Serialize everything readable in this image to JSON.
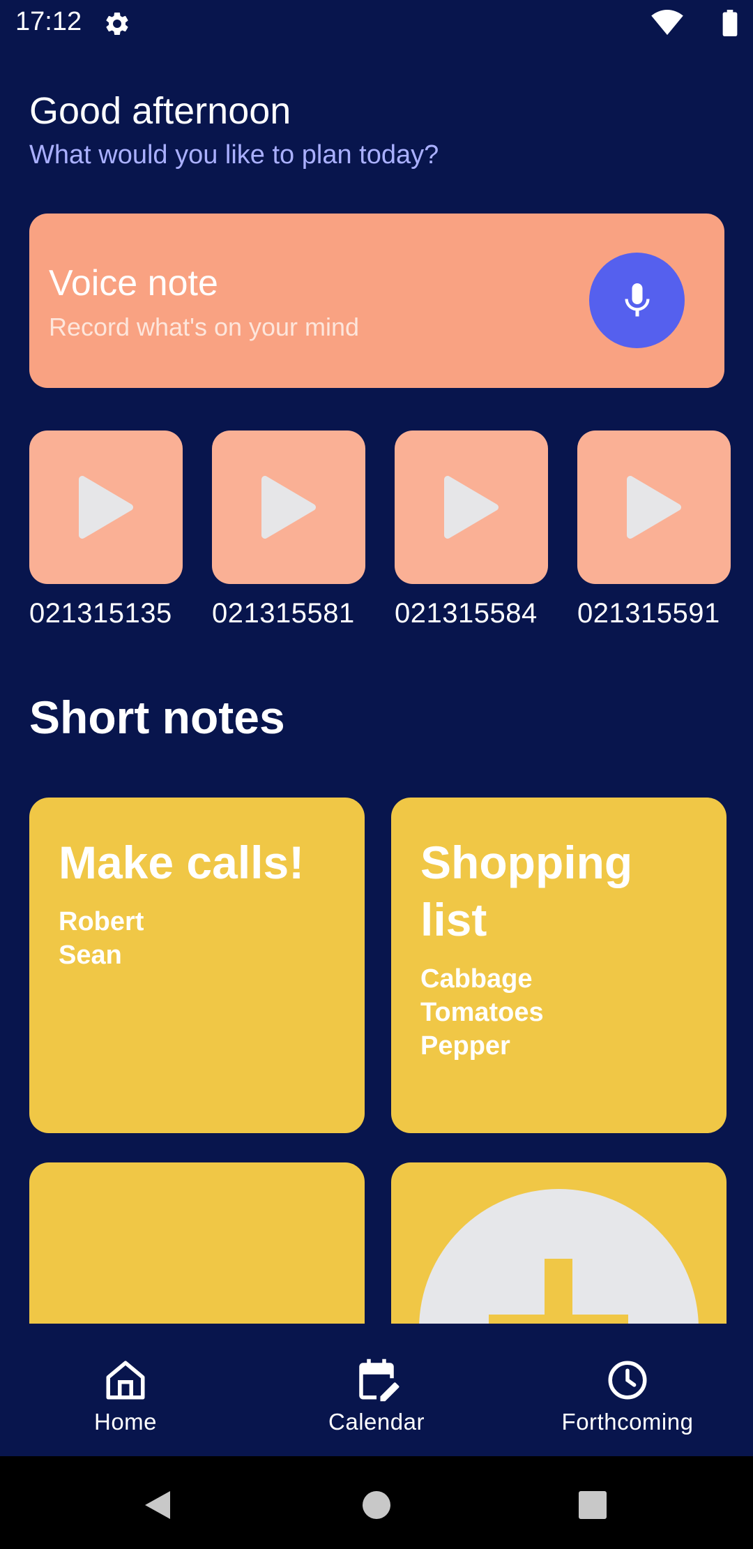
{
  "status_bar": {
    "time": "17:12",
    "icons": [
      "gear-icon",
      "wifi-icon",
      "battery-icon"
    ]
  },
  "greeting": {
    "title": "Good afternoon",
    "subtitle": "What would you like to plan today?"
  },
  "voice_note": {
    "title": "Voice note",
    "subtitle": "Record what's on your mind",
    "button_icon": "microphone-icon"
  },
  "recordings": [
    {
      "label": "021315135"
    },
    {
      "label": "021315581"
    },
    {
      "label": "021315584"
    },
    {
      "label": "021315591"
    }
  ],
  "short_notes": {
    "title": "Short notes",
    "cards": [
      {
        "title": "Make calls!",
        "lines": [
          "Robert",
          "Sean"
        ]
      },
      {
        "title": "Shopping list",
        "lines": [
          "Cabbage",
          "Tomatoes",
          "Pepper"
        ]
      },
      {
        "title": "",
        "lines": []
      }
    ],
    "add_icon": "plus-icon"
  },
  "bottom_nav": {
    "items": [
      {
        "label": "Home",
        "icon": "home-icon"
      },
      {
        "label": "Calendar",
        "icon": "calendar-edit-icon"
      },
      {
        "label": "Forthcoming",
        "icon": "clock-icon"
      }
    ]
  },
  "system_nav": {
    "buttons": [
      "back-icon",
      "home-circle-icon",
      "recents-icon"
    ]
  },
  "colors": {
    "background": "#08154d",
    "voice_card": "#f9a282",
    "recording_thumb": "#fab095",
    "mic_button": "#5560ee",
    "note_card": "#f0c746",
    "subtitle_text": "#aab0ff"
  }
}
